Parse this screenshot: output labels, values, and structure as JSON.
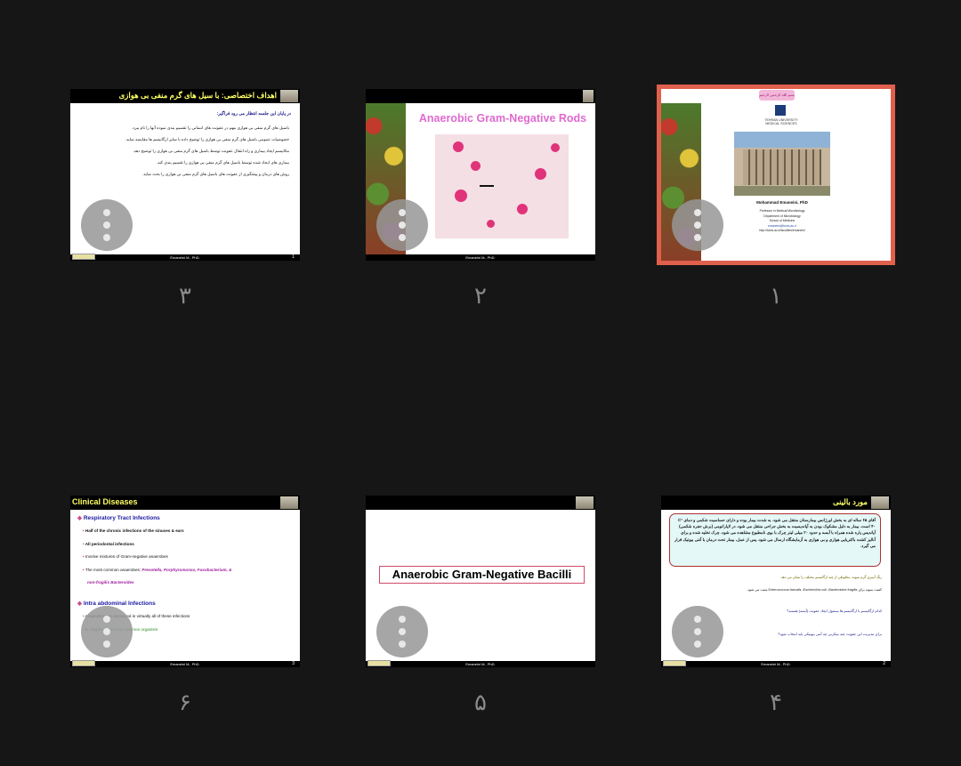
{
  "slides": [
    {
      "number": "۱",
      "selected": true,
      "header_banner": "بسم الله الرحمن الرحیم",
      "university_line1": "TEHRAN UNIVERSITY",
      "university_line2": "MEDICAL SCIENCES",
      "author": "Mohammad  Emaneini, PhD",
      "author_title": "Professor in Medical Microbiology",
      "department": "Department of Microbiology",
      "school": "School of Medicine",
      "email": "emaneini@tums.ac.ir",
      "website": "http://tums.ac.ir/faculties/emaneini"
    },
    {
      "number": "۲",
      "title": "Anaerobic Gram-Negative Rods",
      "footer": "Emaneini M., PhD."
    },
    {
      "number": "۳",
      "title": "اهداف اختصاصی: با سیل های گرم منفی بی هوازی",
      "intro": "در پایان این جلسه انتظار می رود فراگیر:",
      "bullets": [
        "باسیل های گرم منفی بی هوازی مهم در عفونت های انسانی را تقسیم بندی نموده آنها را نام ببرد.",
        "خصوصیات عمومی باسیل های گرم منفی بی هوازی را توضیح داده با سایر ارگانیسم ها مقایسه نماید.",
        "مکانیسم ایجاد بیماری و راه انتقال عفونت توسط باسیل های گرم منفی بی هوازی را توضیح دهد.",
        "بیماری های ایجاد شده توسط باسیل های گرم منفی بی هوازی را تقسیم بندی کند.",
        "روش های درمان و پیشگیری از عفونت های باسیل های گرم منفی بی هوازی را بحث نماید."
      ],
      "footer": "Emaneini M., PhD.",
      "page": "1"
    },
    {
      "number": "۴",
      "title": "مورد بالینی",
      "case_text": "آقای ۶۵ ساله ای به بخش اورژانس بیمارستان منتقل می شود. به شدت بیمار بوده و دارای حساسیت شکمی و دمای C° ۴۰ است. بیمار به دلیل مشکوک بودن به آپاندیسیت به بخش جراحی منتقل می شود. در لاپاراتومی (برش حفره شکمی) آپاندیس پاره شده همراه با آبسه و حدود ۲۰ میلی لیتر چرک با بوی نامطبوع مشاهده می شود. چرک تخلیه شده و برای آنالیز کشت باکتریایی هوازی و بی هوازی به آزمایشگاه ارسال می شود. پس از عمل، بیمار تحت درمان با آنتی بیوتیک قرار می گیرد.",
      "line1": "رنگ آمیزی گرم نمونه، مخلوطی از چند ارگانیسم مختلف را نشان می دهد.",
      "line2": "کشت نمونه برای Enterococcus faecalis ،Escherichia coli ،Bacteroides fragilis مثبت می شود.",
      "q1": "کدام ارگانیسم یا ارگانیسم ها مسئول ایجاد عفونت (آبسه) هستند؟",
      "q2": "برای مدیریت این عفونت چند میکربی چه آنتی بیوتیکی باید انتخاب شود؟",
      "footer": "Emaneini M., PhD.",
      "page": "2"
    },
    {
      "number": "۵",
      "title": "Anaerobic Gram-Negative Bacilli",
      "footer": "Emaneini M., PhD."
    },
    {
      "number": "۶",
      "title": "Clinical Diseases",
      "section1": "Respiratory Tract Infections",
      "s1_items": [
        "Half of the chronic infections of the sinuses & ears",
        "All periodontal infections",
        "Involve mixtures of Gram-negative anaerobes",
        "The most common anaerobes:",
        "non-fragilis Bacteroides"
      ],
      "s1_genera": "Prevotella, Porphyromonas, Fusobacterium, &",
      "section2": "Intra abdominal Infections",
      "s2_items": [
        "Anaerobes are recovered in virtually all of these infections",
        "B. fragilis is the most common organism"
      ],
      "footer": "Emaneini M., PhD.",
      "page": "3"
    }
  ],
  "colors": {
    "selected_border": "#e0604e",
    "background": "#161616",
    "title_yellow": "#ffff66",
    "pink_title": "#e06ad0"
  }
}
